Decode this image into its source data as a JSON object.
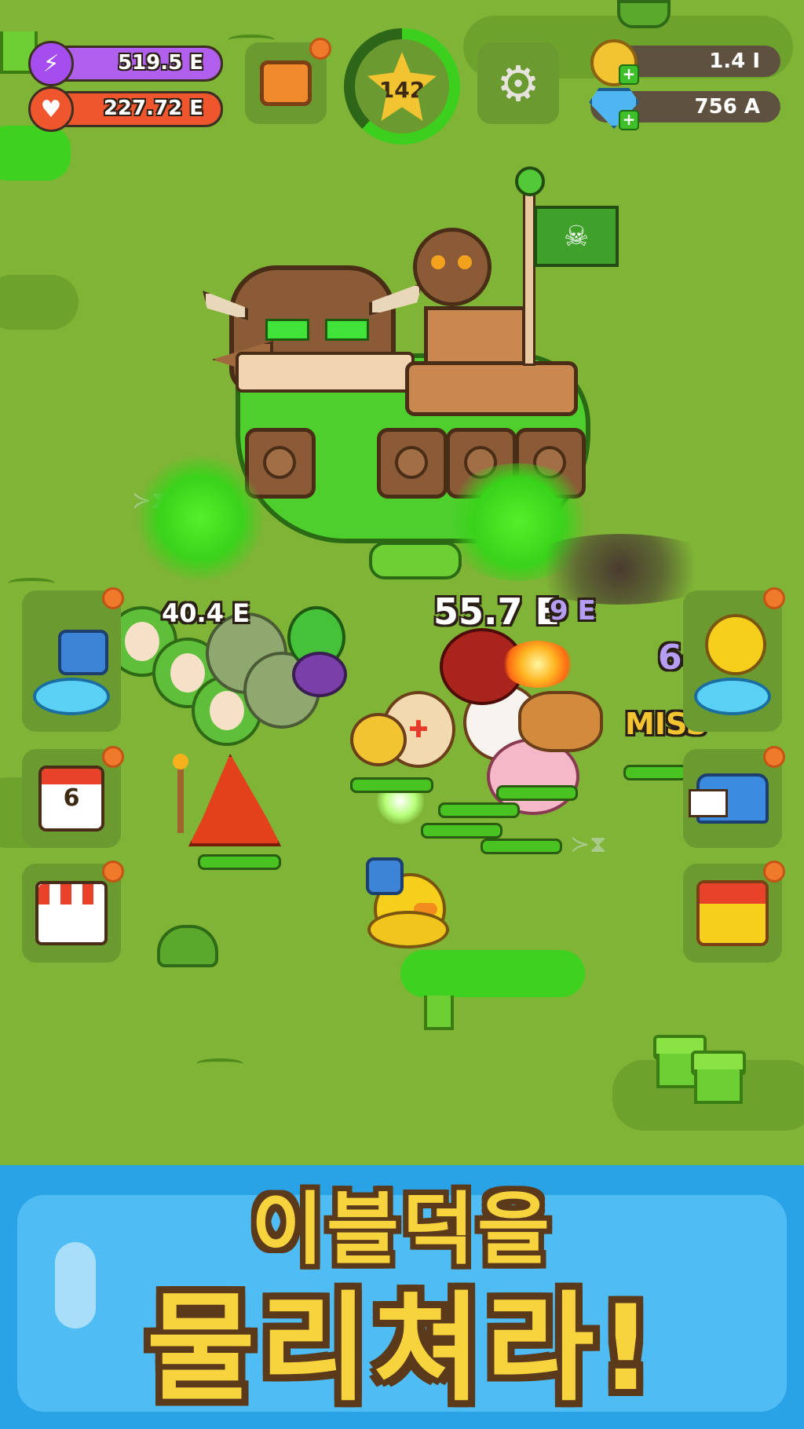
{
  "hud": {
    "energy": {
      "value": "519.5 E",
      "icon": "lightning-icon",
      "color": "#a64df0"
    },
    "health": {
      "value": "227.72 E",
      "icon": "heart-icon",
      "color": "#f0562e"
    },
    "gold": {
      "value": "1.4 I",
      "icon": "coin-icon"
    },
    "gems": {
      "value": "756 A",
      "icon": "diamond-icon"
    },
    "stage_level": "142",
    "stage_progress": 0.62,
    "chest_button": "chest-icon",
    "settings_button": "gear-icon"
  },
  "side_buttons": {
    "left": [
      {
        "name": "summon-portal-button",
        "icon": "trumpet-duck-icon"
      },
      {
        "name": "calendar-button",
        "icon": "calendar-icon",
        "day": "6"
      },
      {
        "name": "shop-button",
        "icon": "shop-icon"
      }
    ],
    "right": [
      {
        "name": "boss-portal-button",
        "icon": "duck-bubble-icon"
      },
      {
        "name": "mailbox-button",
        "icon": "mailbox-icon"
      },
      {
        "name": "treasure-button",
        "icon": "treasure-chest-icon"
      }
    ]
  },
  "damage_numbers": [
    "40.4 E",
    "55.7 E",
    "9 E",
    "64",
    "E",
    "MISS"
  ],
  "banner": {
    "line1": "이블덕을",
    "line2": "물리쳐라!"
  }
}
